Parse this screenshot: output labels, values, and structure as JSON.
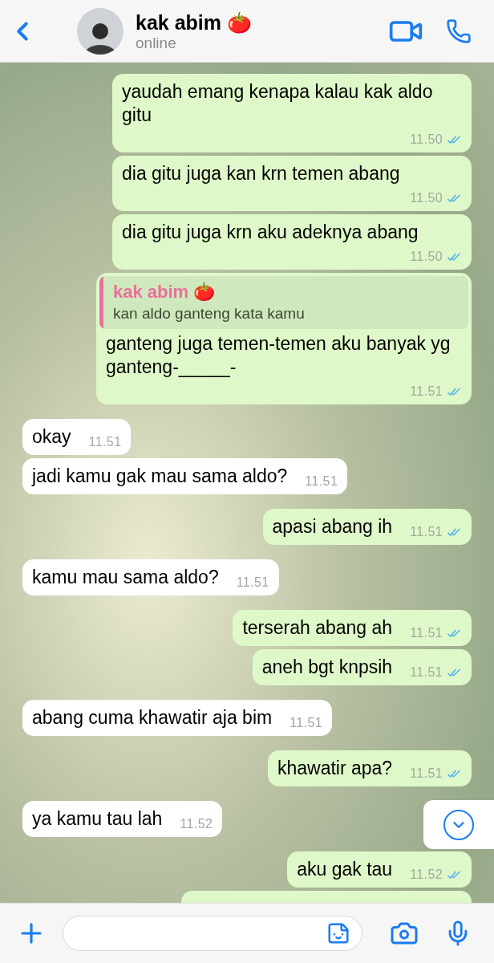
{
  "header": {
    "name": "kak abim 🍅",
    "status": "online"
  },
  "messages": [
    {
      "kind": "outgoing",
      "text": "yaudah emang kenapa kalau kak aldo gitu",
      "time": "11.50"
    },
    {
      "kind": "outgoing",
      "text": "dia gitu juga kan krn temen abang",
      "time": "11.50"
    },
    {
      "kind": "outgoing",
      "text": "dia gitu juga krn aku adeknya abang",
      "time": "11.50"
    },
    {
      "kind": "outgoing",
      "reply": {
        "author": "kak abim 🍅",
        "text": "kan aldo ganteng kata kamu"
      },
      "text": "ganteng juga temen-temen aku banyak yg ganteng-_____-",
      "time": "11.51"
    },
    {
      "kind": "incoming",
      "text": "okay",
      "time": "11.51"
    },
    {
      "kind": "incoming",
      "text": "jadi kamu gak mau sama aldo?",
      "time": "11.51"
    },
    {
      "kind": "outgoing",
      "text": "apasi abang ih",
      "time": "11.51"
    },
    {
      "kind": "incoming",
      "text": "kamu mau sama aldo?",
      "time": "11.51"
    },
    {
      "kind": "outgoing",
      "text": "terserah abang ah",
      "time": "11.51"
    },
    {
      "kind": "outgoing",
      "text": "aneh bgt knpsih",
      "time": "11.51"
    },
    {
      "kind": "incoming",
      "text": "abang cuma khawatir aja bim",
      "time": "11.51"
    },
    {
      "kind": "outgoing",
      "text": "khawatir apa?",
      "time": "11.51"
    },
    {
      "kind": "incoming",
      "text": "ya kamu tau lah",
      "time": "11.52"
    },
    {
      "kind": "outgoing",
      "text": "aku gak tau",
      "time": "11.52"
    },
    {
      "kind": "outgoing"
    }
  ]
}
